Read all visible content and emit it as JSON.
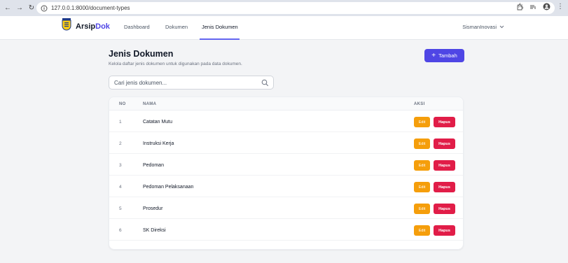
{
  "browser": {
    "url": "127.0.0.1:8000/document-types"
  },
  "app": {
    "brand_main": "Arsip",
    "brand_accent": "Dok",
    "nav": [
      {
        "label": "Dashboard"
      },
      {
        "label": "Dokumen"
      },
      {
        "label": "Jenis Dokumen",
        "active": true
      }
    ],
    "user": "SismanInovasi"
  },
  "page": {
    "title": "Jenis Dokumen",
    "subtitle": "Kelola daftar jenis dokumen untuk digunakan pada data dokumen.",
    "add_button": "Tambah"
  },
  "search": {
    "placeholder": "Cari jenis dokumen..."
  },
  "table": {
    "headers": {
      "no": "NO",
      "nama": "NAMA",
      "aksi": "AKSI"
    },
    "edit_label": "Edit",
    "delete_label": "Hapus",
    "rows": [
      {
        "no": "1",
        "nama": "Catatan Mutu"
      },
      {
        "no": "2",
        "nama": "Instruksi Kerja"
      },
      {
        "no": "3",
        "nama": "Pedoman"
      },
      {
        "no": "4",
        "nama": "Pedoman Pelaksanaan"
      },
      {
        "no": "5",
        "nama": "Prosedur"
      },
      {
        "no": "6",
        "nama": "SK Direksi"
      }
    ]
  },
  "colors": {
    "accent": "#4f46e5",
    "edit": "#f59e0b",
    "delete": "#e11d48"
  }
}
